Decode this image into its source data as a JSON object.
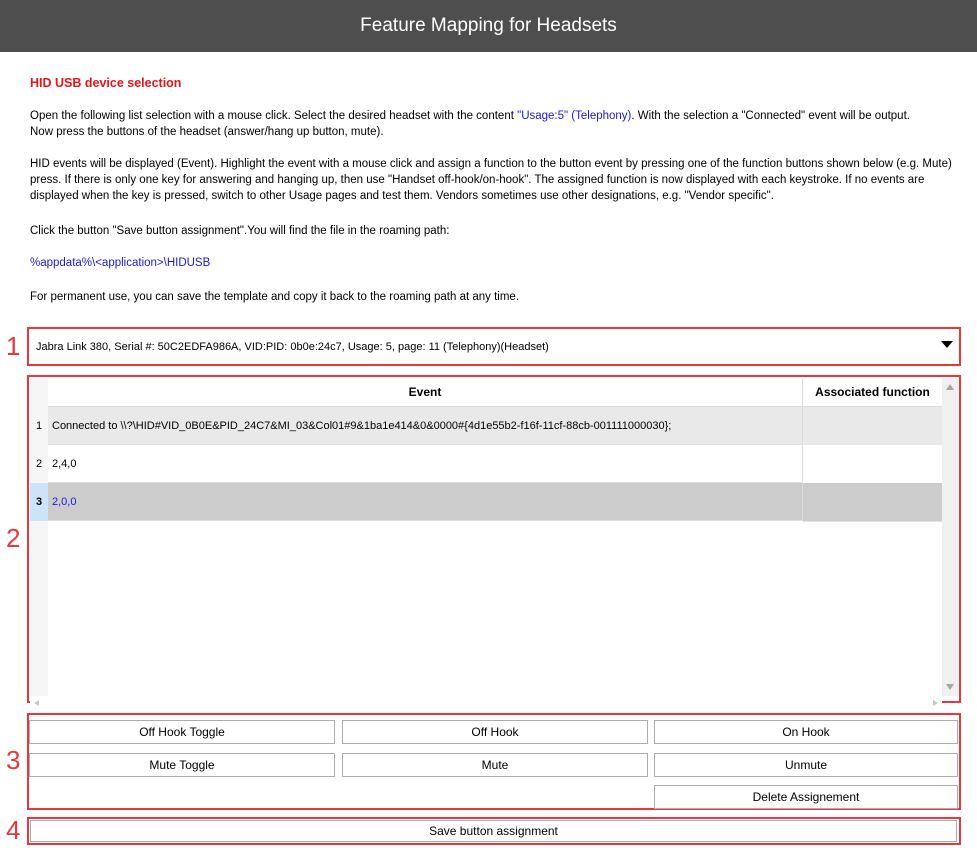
{
  "window": {
    "title": "Feature Mapping for Headsets"
  },
  "intro": {
    "heading": "HID USB device selection",
    "p1_a": "Open the following list selection with a mouse click. Select the desired headset with the content ",
    "p1_link": "\"Usage:5\" (Telephony)",
    "p1_b": ". With the selection a \"Connected\" event will be output.",
    "p1_c": "Now press the buttons of the headset (answer/hang up button, mute).",
    "p2": "HID events will be displayed (Event). Highlight the event with a mouse click and assign a function to the button event by pressing one of the function buttons shown below (e.g. Mute) press. If there is only one key for answering and hanging up, then use \"Handset off-hook/on-hook\". The assigned function is now displayed with each keystroke. If no events are displayed when the key is pressed, switch to other Usage pages and test them. Vendors sometimes use other designations, e.g. \"Vendor specific\".",
    "p3": "Click the button \"Save button assignment\".You will find the file in the roaming path:",
    "path": "%appdata%\\<application>\\HIDUSB",
    "p4": "For permanent use, you can save the template and copy it back to the roaming path at any time."
  },
  "markers": {
    "m1": "1",
    "m2": "2",
    "m3": "3",
    "m4": "4"
  },
  "device_select": {
    "selected": "Jabra Link 380, Serial #: 50C2EDFA986A, VID:PID: 0b0e:24c7, Usage: 5, page: 11 (Telephony)(Headset)"
  },
  "grid": {
    "columns": {
      "event": "Event",
      "function": "Associated function"
    },
    "rows": [
      {
        "num": "1",
        "event": "Connected to \\\\?\\HID#VID_0B0E&PID_24C7&MI_03&Col01#9&1ba1e414&0&0000#{4d1e55b2-f16f-11cf-88cb-001111000030};",
        "function": ""
      },
      {
        "num": "2",
        "event": "2,4,0",
        "function": ""
      },
      {
        "num": "3",
        "event": "2,0,0",
        "function": ""
      }
    ]
  },
  "buttons": {
    "off_hook_toggle": "Off Hook Toggle",
    "off_hook": "Off Hook",
    "on_hook": "On Hook",
    "mute_toggle": "Mute Toggle",
    "mute": "Mute",
    "unmute": "Unmute",
    "delete_assignment": "Delete Assignement",
    "save": "Save button assignment"
  },
  "colors": {
    "titlebar": "#4e4e4e",
    "heading": "#e8141b",
    "link": "#1a1adc",
    "annotation": "#e8383d",
    "selected_row": "#cccccc"
  }
}
